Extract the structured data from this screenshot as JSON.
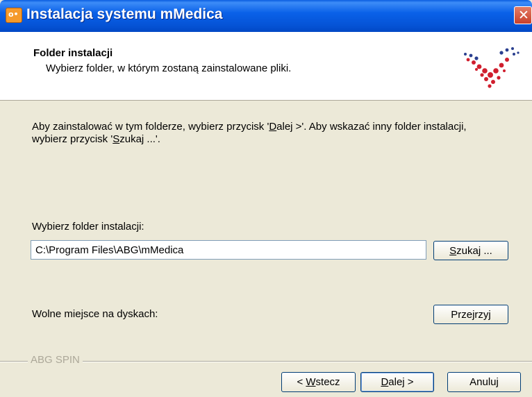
{
  "window": {
    "title": "Instalacja systemu mMedica",
    "close_glyph": "✕"
  },
  "header": {
    "title": "Folder instalacji",
    "subtitle": "Wybierz folder, w którym zostaną zainstalowane pliki.",
    "logo_icon": "logo-icon"
  },
  "body": {
    "description_line1_pre": "Aby zainstalować w tym folderze, wybierz przycisk '",
    "description_line1_ul": "D",
    "description_line1_post": "alej >'. Aby wskazać inny folder instalacji,",
    "description_line2_pre": "wybierz przycisk '",
    "description_line2_ul": "S",
    "description_line2_post": "zukaj ...'.",
    "folder_label": "Wybierz folder instalacji:",
    "folder_value": "C:\\Program Files\\ABG\\mMedica",
    "browse_ul": "S",
    "browse_rest": "zukaj ...",
    "free_space_label": "Wolne miejsce na dyskach:",
    "review_pre": "Prze",
    "review_ul": "j",
    "review_post": "rzyj"
  },
  "footer": {
    "group_label": "ABG SPIN",
    "back_pre": "< ",
    "back_ul": "W",
    "back_post": "stecz",
    "next_ul": "D",
    "next_post": "alej >",
    "cancel_label": "Anuluj"
  },
  "colors": {
    "titlebar": "#0a5ee0",
    "dialog_bg": "#ece9d8",
    "logo_red": "#d01f2e",
    "logo_blue": "#2a3f8f"
  }
}
